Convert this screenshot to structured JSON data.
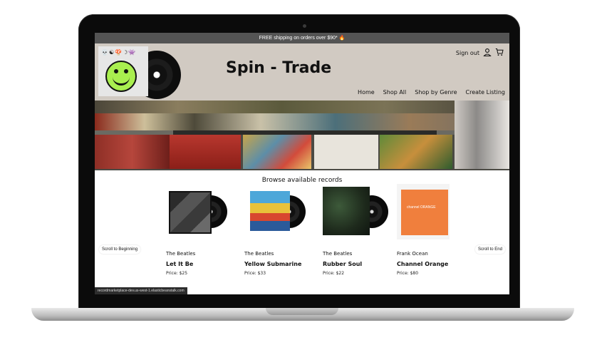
{
  "promo": {
    "text": "FREE shipping on orders over $90* 🔥"
  },
  "header": {
    "logo_text": "💀☯🍄☽👾",
    "site_title": "Spin - Trade",
    "sign_out_label": "Sign out",
    "nav": [
      "Home",
      "Shop All",
      "Shop by Genre",
      "Create Listing"
    ]
  },
  "main": {
    "browse_title": "Browse available records",
    "scroll_left_label": "Scroll to Beginning",
    "scroll_right_label": "Scroll to End",
    "records": [
      {
        "artist": "The Beatles",
        "title": "Let It Be",
        "price": "Price: $25"
      },
      {
        "artist": "The Beatles",
        "title": "Yellow Submarine",
        "price": "Price: $33"
      },
      {
        "artist": "The Beatles",
        "title": "Rubber Soul",
        "price": "Price: $22"
      },
      {
        "artist": "Frank Ocean",
        "title": "Channel Orange",
        "price": "Price: $80"
      }
    ],
    "channel_cover_text": "channel ORANGE"
  },
  "status_url": "recordmarketplace-dev.us-west-1.elasticbeanstalk.com",
  "colors": {
    "header_bg": "#d1cac2",
    "promo_bg": "#545454",
    "logo_green": "#a9ef4f",
    "channel_orange": "#f07f3d"
  }
}
